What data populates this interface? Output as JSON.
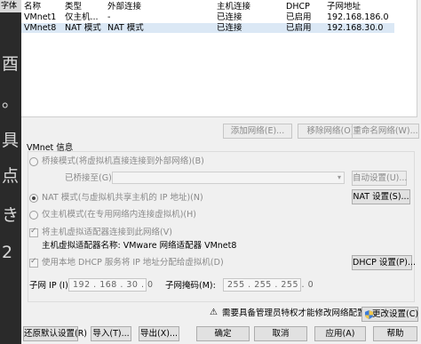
{
  "background_app": {
    "strip_top_text": "字体",
    "glyphs": [
      "酉",
      "。",
      "具",
      "点",
      "き",
      "2"
    ]
  },
  "columns": [
    "名称",
    "类型",
    "外部连接",
    "主机连接",
    "DHCP",
    "子网地址"
  ],
  "rows": [
    [
      "VMnet1",
      "仅主机...",
      "-",
      "已连接",
      "已启用",
      "192.168.186.0"
    ],
    [
      "VMnet8",
      "NAT 模式",
      "NAT 模式",
      "已连接",
      "已启用",
      "192.168.30.0"
    ]
  ],
  "table_buttons": {
    "add": "添加网络(E)...",
    "remove": "移除网络(O)",
    "rename": "重命名网络(W)..."
  },
  "vmnet_info": {
    "group_title": "VMnet 信息",
    "bridged_label": "桥接模式(将虚拟机直接连接到外部网络)(B)",
    "bridged_to_label": "已桥接至(G):",
    "bridged_to_value": "",
    "auto_settings": "自动设置(U)...",
    "nat_label": "NAT 模式(与虚拟机共享主机的 IP 地址)(N)",
    "nat_settings": "NAT 设置(S)...",
    "hostonly_label": "仅主机模式(在专用网络内连接虚拟机)(H)",
    "connect_adapter_label": "将主机虚拟适配器连接到此网络(V)",
    "adapter_name_label": "主机虚拟适配器名称: VMware 网络适配器 VMnet8",
    "dhcp_label": "使用本地 DHCP 服务将 IP 地址分配给虚拟机(D)",
    "dhcp_settings": "DHCP 设置(P)...",
    "subnet_ip_label": "子网 IP (I):",
    "subnet_ip_value": "192 . 168 . 30 . 0",
    "subnet_mask_label": "子网掩码(M):",
    "subnet_mask_value": "255 . 255 . 255 . 0",
    "selected_mode": "nat",
    "connect_adapter_checked": true,
    "dhcp_checked": true
  },
  "admin_notice": "需要具备管理员特权才能修改网络配置。",
  "change_settings": "更改设置(C)",
  "bottom_buttons": {
    "restore": "还原默认设置(R)",
    "import": "导入(T)...",
    "export": "导出(X)...",
    "ok": "确定",
    "cancel": "取消",
    "apply": "应用(A)",
    "help": "帮助"
  }
}
